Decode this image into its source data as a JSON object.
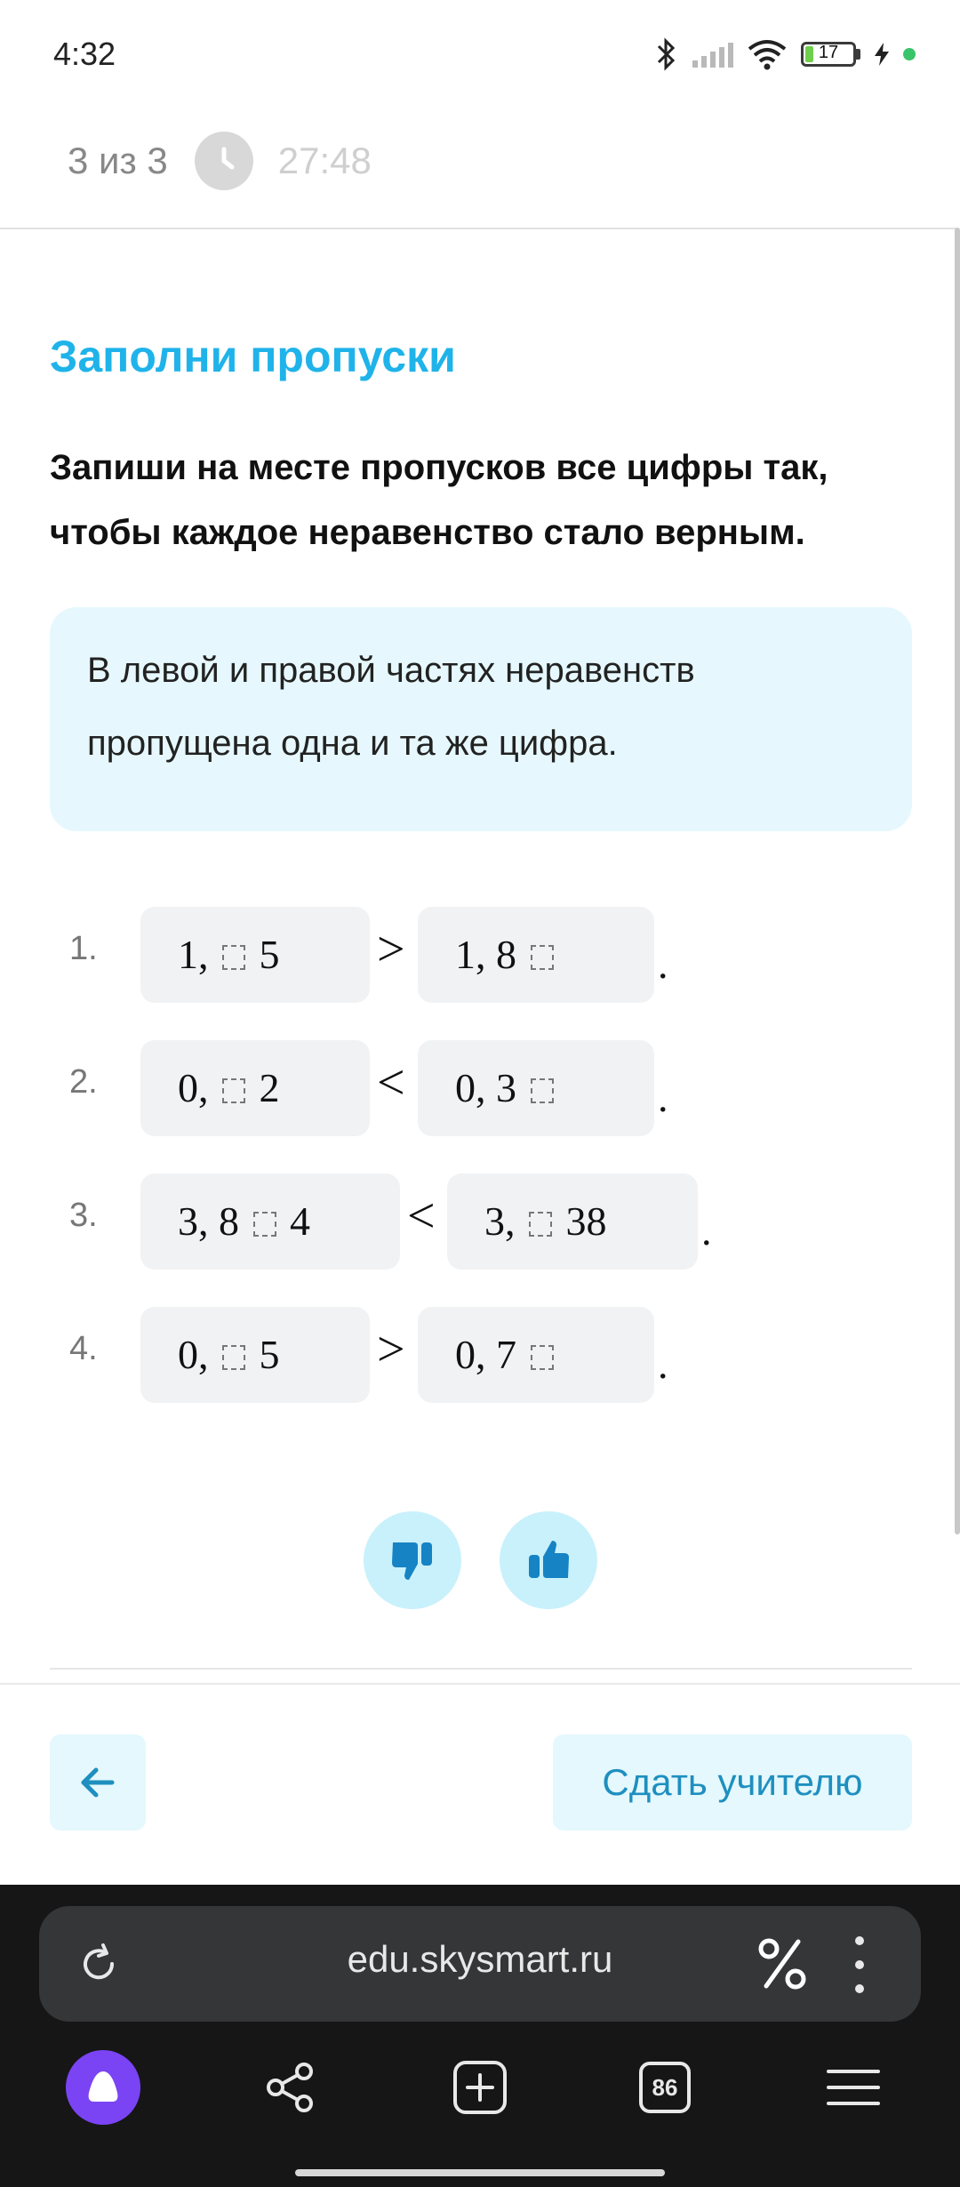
{
  "status_bar": {
    "time": "4:32",
    "battery_level": "17",
    "battery_fraction": 0.17
  },
  "progress": {
    "count": "3 из 3",
    "timer": "27:48"
  },
  "task": {
    "title": "Заполни пропуски",
    "description": "Запиши на месте пропусков все цифры так, чтобы каждое неравенство стало верным.",
    "hint": "В левой и правой частях неравенств пропущена одна и та же цифра."
  },
  "inequalities": [
    {
      "number": "1.",
      "left_before": "1, ",
      "left_after": " 5",
      "sign": ">",
      "right_before": "1, 8 ",
      "right_after": ""
    },
    {
      "number": "2.",
      "left_before": "0, ",
      "left_after": " 2",
      "sign": "<",
      "right_before": "0, 3 ",
      "right_after": ""
    },
    {
      "number": "3.",
      "left_before": "3, 8 ",
      "left_after": " 4",
      "sign": "<",
      "right_before": "3, ",
      "right_after": " 38"
    },
    {
      "number": "4.",
      "left_before": "0, ",
      "left_after": " 5",
      "sign": ">",
      "right_before": "0, 7 ",
      "right_after": ""
    }
  ],
  "navigation": {
    "submit_label": "Сдать учителю"
  },
  "browser": {
    "url": "edu.skysmart.ru",
    "tabs_count": "86"
  },
  "icons": {
    "timer": "clock-icon",
    "dislike": "thumbs-down-icon",
    "like": "thumbs-up-icon",
    "back": "arrow-left-icon",
    "reload": "reload-icon",
    "percent": "percent-icon",
    "menu": "kebab-icon",
    "alice": "alice-icon",
    "share": "share-icon",
    "new_tab": "plus-square-icon",
    "hamburger": "hamburger-icon"
  },
  "colors": {
    "accent": "#1fb3ea",
    "hint_bg": "#e6f8fd",
    "button_bg": "#e4f8fd",
    "button_text": "#1e8fbf",
    "alice": "#7a44f4"
  }
}
